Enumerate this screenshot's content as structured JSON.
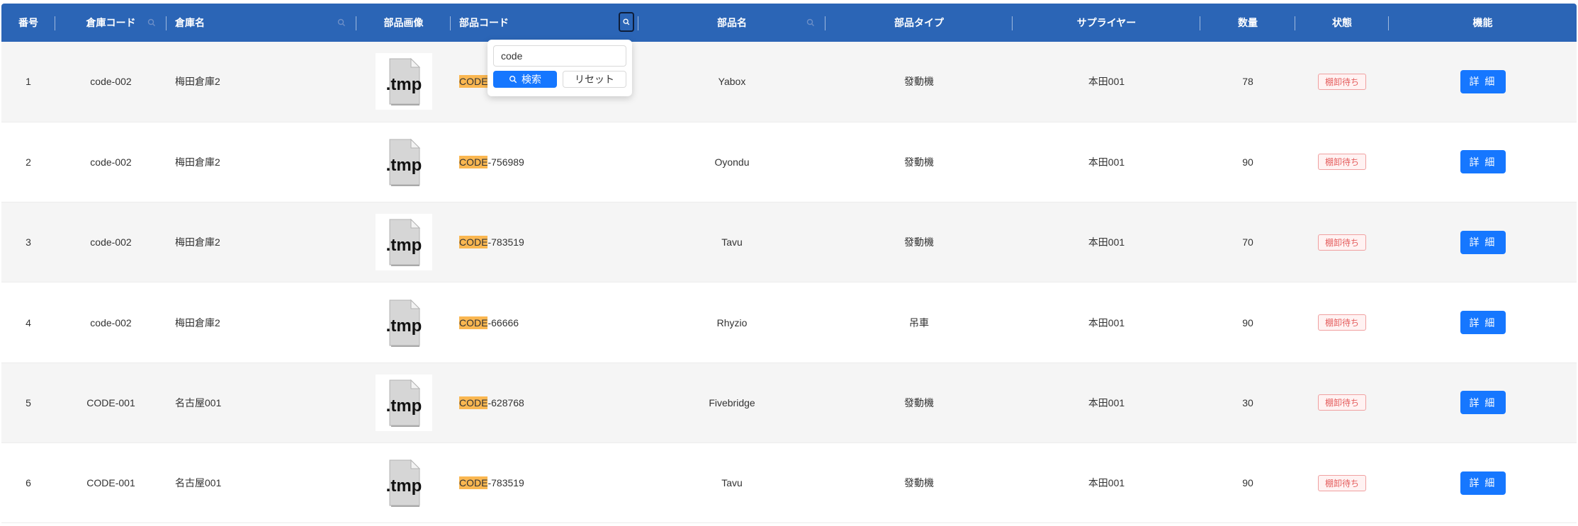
{
  "columns": {
    "no": "番号",
    "warehouse_code": "倉庫コード",
    "warehouse_name": "倉庫名",
    "part_image": "部品画像",
    "part_code": "部品コード",
    "part_name": "部品名",
    "part_type": "部品タイプ",
    "supplier": "サプライヤー",
    "quantity": "数量",
    "status": "状態",
    "actions": "機能"
  },
  "filter": {
    "value": "code",
    "search_label": "検索",
    "reset_label": "リセット",
    "search_icon": "search-icon"
  },
  "accent_color": "#1677ff",
  "header_color": "#2b65b6",
  "highlight_color": "#fab751",
  "rows": [
    {
      "no": "1",
      "wh_code": "code-002",
      "wh_name": "梅田倉庫2",
      "image_label": ".tmp",
      "code_hl": "CODE",
      "code_rest": "",
      "part_name": "Yabox",
      "part_type": "發動機",
      "supplier": "本田001",
      "qty": "78",
      "status": "棚卸待ち",
      "action": "詳 細"
    },
    {
      "no": "2",
      "wh_code": "code-002",
      "wh_name": "梅田倉庫2",
      "image_label": ".tmp",
      "code_hl": "CODE",
      "code_rest": "-756989",
      "part_name": "Oyondu",
      "part_type": "發動機",
      "supplier": "本田001",
      "qty": "90",
      "status": "棚卸待ち",
      "action": "詳 細"
    },
    {
      "no": "3",
      "wh_code": "code-002",
      "wh_name": "梅田倉庫2",
      "image_label": ".tmp",
      "code_hl": "CODE",
      "code_rest": "-783519",
      "part_name": "Tavu",
      "part_type": "發動機",
      "supplier": "本田001",
      "qty": "70",
      "status": "棚卸待ち",
      "action": "詳 細"
    },
    {
      "no": "4",
      "wh_code": "code-002",
      "wh_name": "梅田倉庫2",
      "image_label": ".tmp",
      "code_hl": "CODE",
      "code_rest": "-66666",
      "part_name": "Rhyzio",
      "part_type": "吊車",
      "supplier": "本田001",
      "qty": "90",
      "status": "棚卸待ち",
      "action": "詳 細"
    },
    {
      "no": "5",
      "wh_code": "CODE-001",
      "wh_name": "名古屋001",
      "image_label": ".tmp",
      "code_hl": "CODE",
      "code_rest": "-628768",
      "part_name": "Fivebridge",
      "part_type": "發動機",
      "supplier": "本田001",
      "qty": "30",
      "status": "棚卸待ち",
      "action": "詳 細"
    },
    {
      "no": "6",
      "wh_code": "CODE-001",
      "wh_name": "名古屋001",
      "image_label": ".tmp",
      "code_hl": "CODE",
      "code_rest": "-783519",
      "part_name": "Tavu",
      "part_type": "發動機",
      "supplier": "本田001",
      "qty": "90",
      "status": "棚卸待ち",
      "action": "詳 細"
    }
  ]
}
